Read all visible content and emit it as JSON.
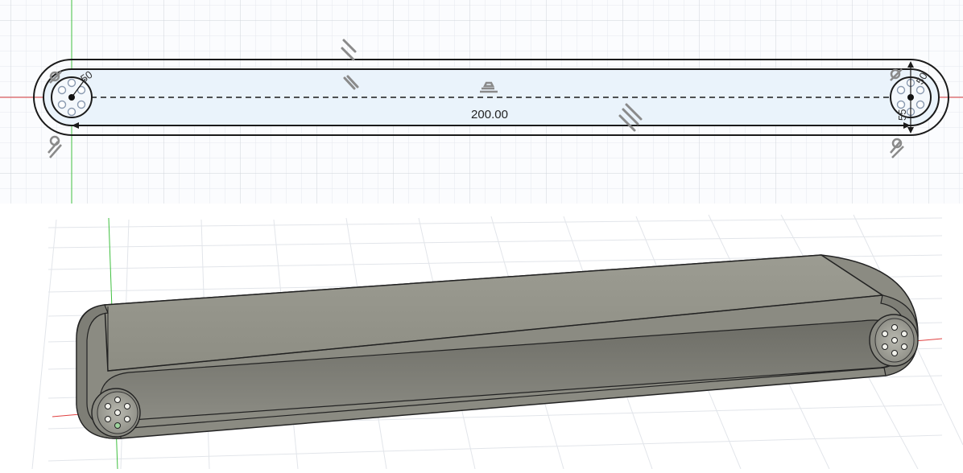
{
  "sketch": {
    "length_dimension": "200.00",
    "roller_diameter_left": "50",
    "roller_diameter_right": "50",
    "roller_outer_right": "55"
  },
  "colors": {
    "grid_minor": "#e6e9ee",
    "grid_major": "#cfd4db",
    "axis_x": "#e04040",
    "axis_y": "#40c040",
    "belt_fill": "#eaf3fb",
    "sketch_line": "#1a1a1a",
    "model_surface": "#8e8e84",
    "model_top": "#9a9a90",
    "model_edge": "#222222"
  },
  "icons": {
    "constraint_parallel": "parallel-constraint-icon",
    "constraint_horizontal": "horizontal-constraint-icon",
    "constraint_tangent": "tangent-constraint-icon"
  }
}
